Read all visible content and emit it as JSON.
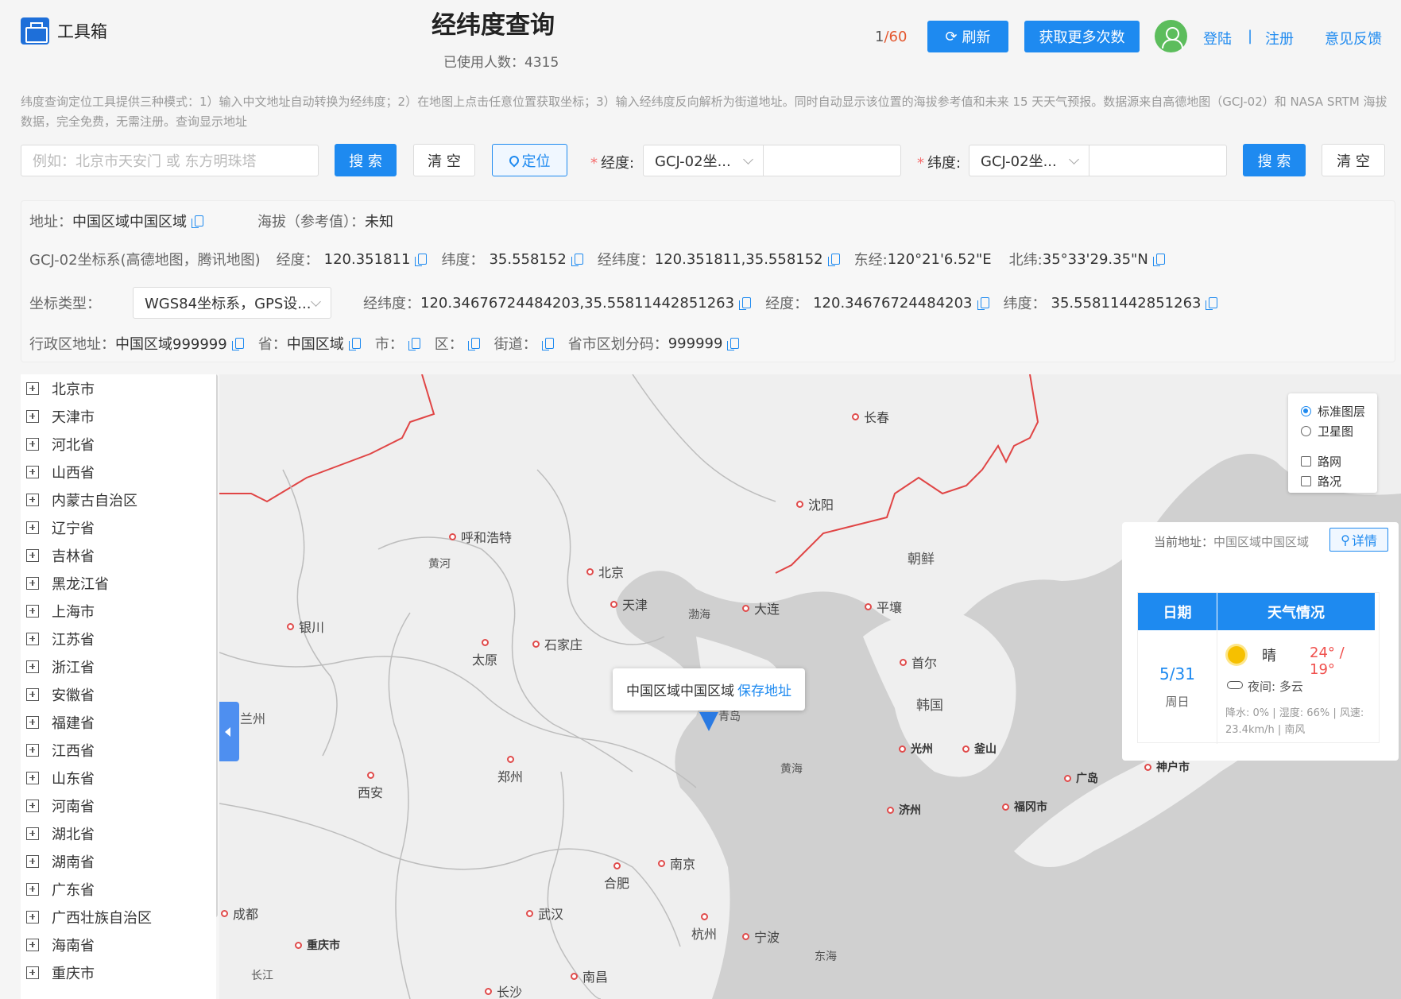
{
  "header": {
    "logo_text": "工具箱",
    "title": "经纬度查询",
    "usage_label": "已使用人数：",
    "usage_count": "4315",
    "quota_used": "1",
    "quota_total": "/60",
    "refresh_label": "刷新",
    "get_more_label": "获取更多次数",
    "login_label": "登陆",
    "separator": "|",
    "register_label": "注册",
    "feedback_label": "意见反馈"
  },
  "description": "纬度查询定位工具提供三种模式：1）输入中文地址自动转换为经纬度；2）在地图上点击任意位置获取坐标；3）输入经纬度反向解析为街道地址。同时自动显示该位置的海拔参考值和未来 15 天天气预报。数据源来自高德地图（GCJ-02）和 NASA SRTM 海拔数据，完全免费，无需注册。查询显示地址",
  "search": {
    "address_placeholder": "例如：北京市天安门 或 东方明珠塔",
    "search_label": "搜 索",
    "clear_label": "清 空",
    "locate_label": "定位",
    "lng_label": "经度:",
    "lat_label": "纬度:",
    "lng_coord_type": "GCJ-02坐...",
    "lat_coord_type": "GCJ-02坐...",
    "lng_value": "",
    "lat_value": "",
    "search2_label": "搜 索",
    "clear2_label": "清 空"
  },
  "info": {
    "address_label": "地址：",
    "address_value": "中国区域中国区域",
    "altitude_label": "海拔（参考值）：",
    "altitude_value": "未知",
    "gcj_label": "GCJ-02坐标系(高德地图，腾讯地图)",
    "lng_label": "经度：",
    "lng_value": "120.351811",
    "lat_label": "纬度：",
    "lat_value": "35.558152",
    "lnglat_label": "经纬度：",
    "lnglat_value": "120.351811,35.558152",
    "east_label": "东经:",
    "east_value": "120°21'6.52\"E",
    "north_label": "北纬:",
    "north_value": "35°33'29.35\"N",
    "coord_type_label": "坐标类型：",
    "coord_type_value": "WGS84坐标系，GPS设...",
    "wgs_lnglat_label": "经纬度：",
    "wgs_lnglat_value": "120.34676724484203,35.55811442851263",
    "wgs_lng_label": "经度：",
    "wgs_lng_value": "120.34676724484203",
    "wgs_lat_label": "纬度：",
    "wgs_lat_value": "35.55811442851263",
    "admin_label": "行政区地址：",
    "admin_value": "中国区域999999",
    "province_label": "省：",
    "province_value": "中国区域",
    "city_label": "市：",
    "district_label": "区：",
    "street_label": "街道：",
    "code_label": "省市区划分码：",
    "code_value": "999999"
  },
  "provinces": [
    "北京市",
    "天津市",
    "河北省",
    "山西省",
    "内蒙古自治区",
    "辽宁省",
    "吉林省",
    "黑龙江省",
    "上海市",
    "江苏省",
    "浙江省",
    "安徽省",
    "福建省",
    "江西省",
    "山东省",
    "河南省",
    "湖北省",
    "湖南省",
    "广东省",
    "广西壮族自治区",
    "海南省",
    "重庆市"
  ],
  "map": {
    "cities": [
      "长春",
      "沈阳",
      "呼和浩特",
      "北京",
      "天津",
      "大连",
      "平壤",
      "银川",
      "石家庄",
      "太原",
      "首尔",
      "郑州",
      "西安",
      "合肥",
      "南京",
      "成都",
      "武汉",
      "重庆市",
      "杭州",
      "宁波",
      "南昌",
      "长沙"
    ],
    "small_cities": [
      "光州",
      "釜山",
      "济州",
      "福冈市",
      "广岛",
      "神户市"
    ],
    "labels": [
      "黄河",
      "渤海",
      "朝鲜",
      "韩国",
      "黄海",
      "东海",
      "长江",
      "兰州",
      "青岛"
    ],
    "popup_address": "中国区域中国区域",
    "popup_save": "保存地址",
    "layers": {
      "standard": "标准图层",
      "satellite": "卫星图",
      "roads": "路网",
      "traffic": "路况"
    }
  },
  "weather": {
    "address_label": "当前地址：",
    "address_value": "中国区域中国区域",
    "detail_label": "详情",
    "col_date": "日期",
    "col_weather": "天气情况",
    "date": "5/31",
    "weekday": "周日",
    "condition": "晴",
    "temp": "24° / 19°",
    "night": "夜间: 多云",
    "meta": "降水: 0% | 湿度: 66% | 风速: 23.4km/h | 南风"
  }
}
